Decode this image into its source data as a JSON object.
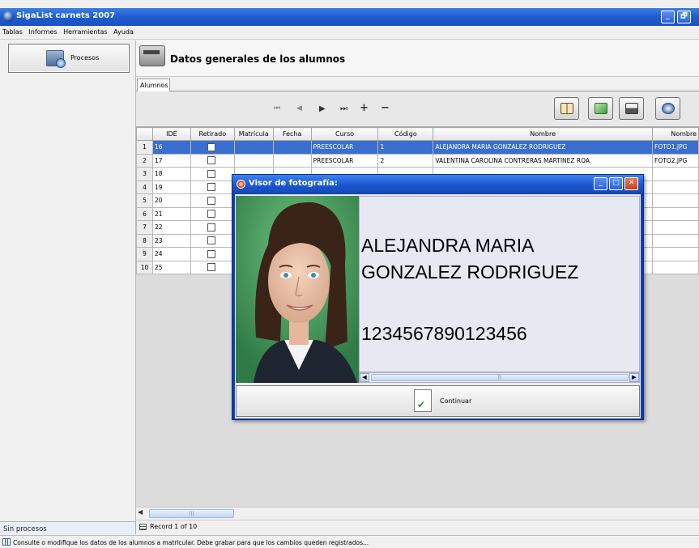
{
  "window": {
    "title": "SigaList carnets 2007",
    "minimize": "_",
    "restore": "🗗"
  },
  "menu": [
    "Tablas",
    "Informes",
    "Herramientas",
    "Ayuda"
  ],
  "left": {
    "procesos_label": "Procesos",
    "status": "Sin procesos"
  },
  "header": {
    "title": "Datos generales de los alumnos"
  },
  "tabs": [
    "Alumnos"
  ],
  "nav": {
    "first": "⏮",
    "prev": "◀",
    "next": "▶",
    "last": "⏭",
    "add": "+",
    "remove": "−"
  },
  "table": {
    "columns": [
      "IDE",
      "Retirado",
      "Matrícula",
      "Fecha",
      "Curso",
      "Código",
      "Nombre",
      "Nombre"
    ],
    "rows": [
      {
        "n": "1",
        "ide": "16",
        "curso": "PREESCOLAR",
        "codigo": "1",
        "nombre": "ALEJANDRA MARIA GONZALEZ RODRIGUEZ",
        "foto": "FOTO1.JPG",
        "selected": true
      },
      {
        "n": "2",
        "ide": "17",
        "curso": "PREESCOLAR",
        "codigo": "2",
        "nombre": "VALENTINA CAROLINA CONTRERAS MARTINEZ ROA",
        "foto": "FOTO2.JPG"
      },
      {
        "n": "3",
        "ide": "18",
        "curso": "",
        "codigo": "",
        "nombre": "",
        "foto": ""
      },
      {
        "n": "4",
        "ide": "19",
        "curso": "",
        "codigo": "",
        "nombre": "",
        "foto": ""
      },
      {
        "n": "5",
        "ide": "20",
        "curso": "",
        "codigo": "",
        "nombre": "",
        "foto": ""
      },
      {
        "n": "6",
        "ide": "21",
        "curso": "",
        "codigo": "",
        "nombre": "",
        "foto": ""
      },
      {
        "n": "7",
        "ide": "22",
        "curso": "",
        "codigo": "",
        "nombre": "",
        "foto": ""
      },
      {
        "n": "8",
        "ide": "23",
        "curso": "",
        "codigo": "",
        "nombre": "",
        "foto": ""
      },
      {
        "n": "9",
        "ide": "24",
        "curso": "",
        "codigo": "",
        "nombre": "",
        "foto": ""
      },
      {
        "n": "10",
        "ide": "25",
        "curso": "",
        "codigo": "",
        "nombre": "",
        "foto": ""
      }
    ]
  },
  "record": "Record 1 of 10",
  "statusline": "Consulte o modifique los datos de los alumnos a matricular. Debe grabar para que los cambios queden registrados...",
  "dialog": {
    "title": "Visor de fotografía:",
    "name_line1": "ALEJANDRA MARIA",
    "name_line2": "GONZALEZ RODRIGUEZ",
    "code": "1234567890123456",
    "continuar": "Continuar"
  },
  "colors": {
    "selection": "#3a6fd0",
    "titlebar": "#1f5ccf",
    "photo_bg": "#4fa165"
  }
}
